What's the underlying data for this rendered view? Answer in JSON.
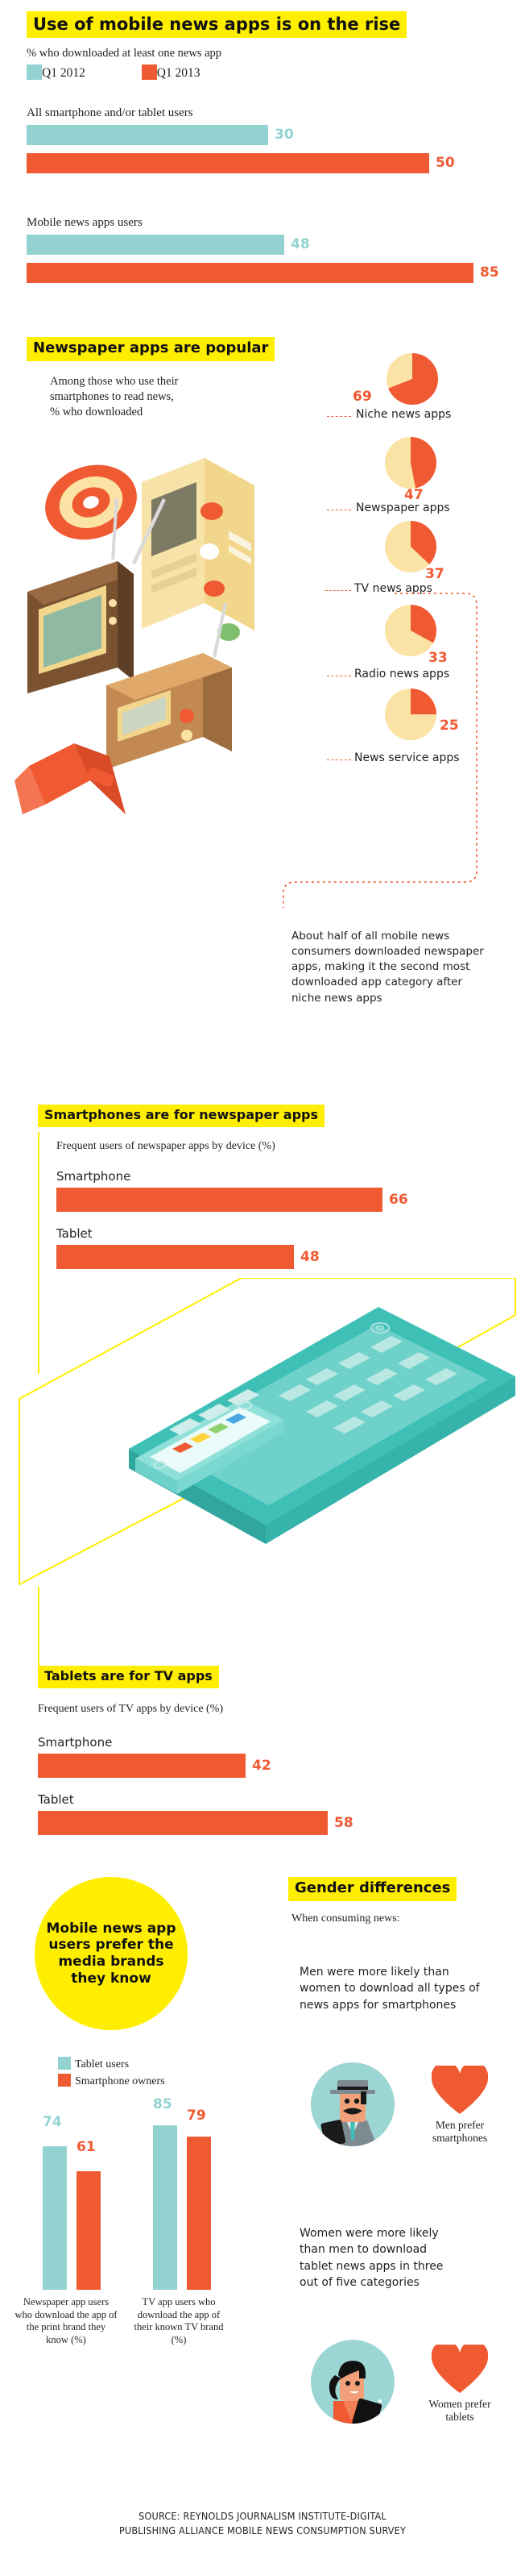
{
  "colors": {
    "teal": "#92d3d1",
    "orange": "#f05a32",
    "yellow": "#ffee00",
    "cream": "#fbe3a5",
    "ink": "#231f20"
  },
  "section1": {
    "title": "Use of mobile news apps is on the rise",
    "subtitle": "% who downloaded at least one news app",
    "legend": [
      {
        "label": "Q1 2012",
        "color": "#92d3d1"
      },
      {
        "label": "Q1 2013",
        "color": "#f05a32"
      }
    ],
    "groups": [
      {
        "label": "All smartphone and/or tablet users",
        "bars": [
          {
            "series": "Q1 2012",
            "value": 30,
            "color": "#92d3d1"
          },
          {
            "series": "Q1 2013",
            "value": 50,
            "color": "#f05a32"
          }
        ]
      },
      {
        "label": "Mobile news apps users",
        "bars": [
          {
            "series": "Q1 2012",
            "value": 48,
            "color": "#92d3d1"
          },
          {
            "series": "Q1 2013",
            "value": 85,
            "color": "#f05a32"
          }
        ]
      }
    ]
  },
  "section2": {
    "title": "Newspaper apps are popular",
    "intro": "Among those who use their smartphones to read news, % who downloaded",
    "pies": [
      {
        "label": "Niche news apps",
        "value": 69
      },
      {
        "label": "Newspaper apps",
        "value": 47
      },
      {
        "label": "TV news apps",
        "value": 37
      },
      {
        "label": "Radio news apps",
        "value": 33
      },
      {
        "label": "News service apps",
        "value": 25
      }
    ],
    "note": "About half of all mobile news consumers downloaded newspaper apps, making it the second most downloaded app category after niche news apps"
  },
  "section3": {
    "title": "Smartphones are for newspaper apps",
    "subtitle": "Frequent users of newspaper apps by device (%)",
    "bars": [
      {
        "label": "Smartphone",
        "value": 66,
        "color": "#f05a32"
      },
      {
        "label": "Tablet",
        "value": 48,
        "color": "#f05a32"
      }
    ]
  },
  "section4": {
    "title": "Tablets are for TV apps",
    "subtitle": "Frequent users of TV apps by device (%)",
    "bars": [
      {
        "label": "Smartphone",
        "value": 42,
        "color": "#f05a32"
      },
      {
        "label": "Tablet",
        "value": 58,
        "color": "#f05a32"
      }
    ]
  },
  "section5": {
    "circle_text": "Mobile news app users prefer the media brands they know",
    "legend": [
      {
        "label": "Tablet users",
        "color": "#92d3d1"
      },
      {
        "label": "Smartphone owners",
        "color": "#f05a32"
      }
    ],
    "categories": [
      "Newspaper app users who download the app of the print brand they know (%)",
      "TV app users who download the app of their known TV brand (%)"
    ],
    "series": [
      {
        "name": "Tablet users",
        "color": "#92d3d1",
        "values": [
          74,
          85
        ]
      },
      {
        "name": "Smartphone owners",
        "color": "#f05a32",
        "values": [
          61,
          79
        ]
      }
    ]
  },
  "gender": {
    "title": "Gender differences",
    "when": "When consuming news:",
    "men_text": "Men were more likely than women to download all types of news apps for smartphones",
    "men_caption": "Men prefer smartphones",
    "women_text": "Women were more likely than men to download tablet news apps in three out of five categories",
    "women_caption": "Women prefer tablets"
  },
  "footer": {
    "line1": "SOURCE: REYNOLDS JOURNALISM INSTITUTE-DIGITAL",
    "line2": "PUBLISHING ALLIANCE MOBILE NEWS CONSUMPTION SURVEY"
  },
  "chart_data": [
    {
      "type": "bar",
      "title": "Use of mobile news apps is on the rise",
      "subtitle": "% who downloaded at least one news app",
      "orientation": "horizontal",
      "categories": [
        "All smartphone and/or tablet users",
        "Mobile news apps users"
      ],
      "series": [
        {
          "name": "Q1 2012",
          "values": [
            30,
            48
          ],
          "color": "#92d3d1"
        },
        {
          "name": "Q1 2013",
          "values": [
            50,
            85
          ],
          "color": "#f05a32"
        }
      ],
      "ylabel": "",
      "xlabel": "%",
      "xlim": [
        0,
        100
      ],
      "grid": false,
      "legend": "top"
    },
    {
      "type": "pie",
      "title": "Newspaper apps are popular",
      "subtitle": "Among those who use their smartphones to read news, % who downloaded",
      "slices": [
        {
          "label": "Niche news apps",
          "value": 69,
          "remainder": 31
        },
        {
          "label": "Newspaper apps",
          "value": 47,
          "remainder": 53
        },
        {
          "label": "TV news apps",
          "value": 37,
          "remainder": 63
        },
        {
          "label": "Radio news apps",
          "value": 33,
          "remainder": 67
        },
        {
          "label": "News service apps",
          "value": 25,
          "remainder": 75
        }
      ],
      "colors": {
        "filled": "#f05a32",
        "empty": "#fbe3a5"
      }
    },
    {
      "type": "bar",
      "title": "Smartphones are for newspaper apps",
      "subtitle": "Frequent users of newspaper apps by device (%)",
      "orientation": "horizontal",
      "categories": [
        "Smartphone",
        "Tablet"
      ],
      "values": [
        66,
        48
      ],
      "xlim": [
        0,
        100
      ],
      "grid": false
    },
    {
      "type": "bar",
      "title": "Tablets are for TV apps",
      "subtitle": "Frequent users of TV apps by device (%)",
      "orientation": "horizontal",
      "categories": [
        "Smartphone",
        "Tablet"
      ],
      "values": [
        42,
        58
      ],
      "xlim": [
        0,
        100
      ],
      "grid": false
    },
    {
      "type": "bar",
      "title": "Mobile news app users prefer the media brands they know",
      "orientation": "vertical",
      "categories": [
        "Newspaper app users who download the app of the print brand they know (%)",
        "TV app users who download the app of their known TV brand (%)"
      ],
      "series": [
        {
          "name": "Tablet users",
          "values": [
            74,
            85
          ],
          "color": "#92d3d1"
        },
        {
          "name": "Smartphone owners",
          "values": [
            61,
            79
          ],
          "color": "#f05a32"
        }
      ],
      "ylim": [
        0,
        100
      ],
      "grid": false,
      "legend": "top-left"
    }
  ]
}
